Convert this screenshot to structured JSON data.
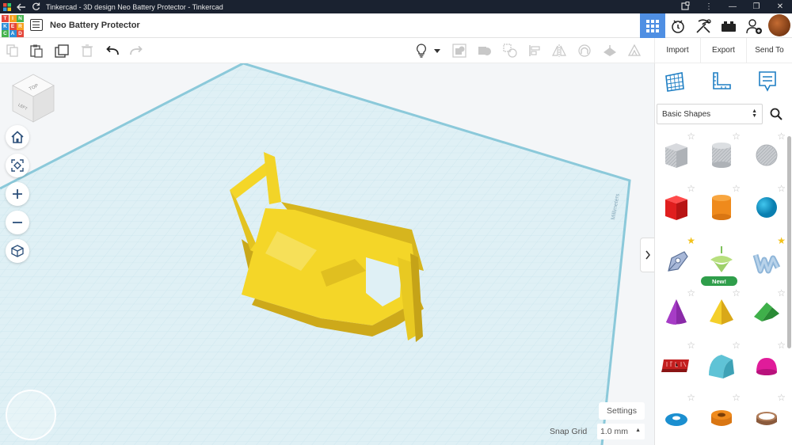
{
  "titlebar": {
    "title": "Tinkercad - 3D design Neo Battery Protector - Tinkercad",
    "minimize": "—",
    "maximize": "❐",
    "close": "✕"
  },
  "logo": {
    "letters": [
      "T",
      "I",
      "N",
      "K",
      "E",
      "R",
      "C",
      "A",
      "D"
    ]
  },
  "header": {
    "design_name": "Neo Battery Protector"
  },
  "rightbar": {
    "import": "Import",
    "export": "Export",
    "send_to": "Send To"
  },
  "library": {
    "selected": "Basic Shapes",
    "shapes": [
      {
        "name": "Box hole",
        "star": "outline"
      },
      {
        "name": "Cylinder hole",
        "star": "outline"
      },
      {
        "name": "Sphere hole",
        "star": "outline"
      },
      {
        "name": "Box",
        "star": "outline"
      },
      {
        "name": "Cylinder",
        "star": "outline"
      },
      {
        "name": "Sphere",
        "star": "outline"
      },
      {
        "name": "Scribble",
        "star": "gold"
      },
      {
        "name": "New shape",
        "star": "none",
        "badge": "New!"
      },
      {
        "name": "Text",
        "star": "gold"
      },
      {
        "name": "Cone",
        "star": "outline"
      },
      {
        "name": "Pyramid",
        "star": "outline"
      },
      {
        "name": "Roof",
        "star": "outline"
      },
      {
        "name": "Text red",
        "star": "outline"
      },
      {
        "name": "Half cylinder",
        "star": "outline"
      },
      {
        "name": "Paraboloid",
        "star": "outline"
      },
      {
        "name": "Torus",
        "star": "outline"
      },
      {
        "name": "Tube",
        "star": "outline"
      },
      {
        "name": "Ring",
        "star": "outline"
      }
    ]
  },
  "viewport": {
    "viewcube": {
      "top": "TOP",
      "left": "LEFT"
    },
    "workplane_label": "Millimeters",
    "settings": "Settings",
    "snap_grid_label": "Snap Grid",
    "snap_grid_value": "1.0 mm"
  },
  "colors": {
    "accent": "#4f8fe3",
    "model": "#f4d628",
    "workplane": "#d8ecf2",
    "grid_line": "#bfe0ea",
    "header_dark": "#1a2230"
  }
}
